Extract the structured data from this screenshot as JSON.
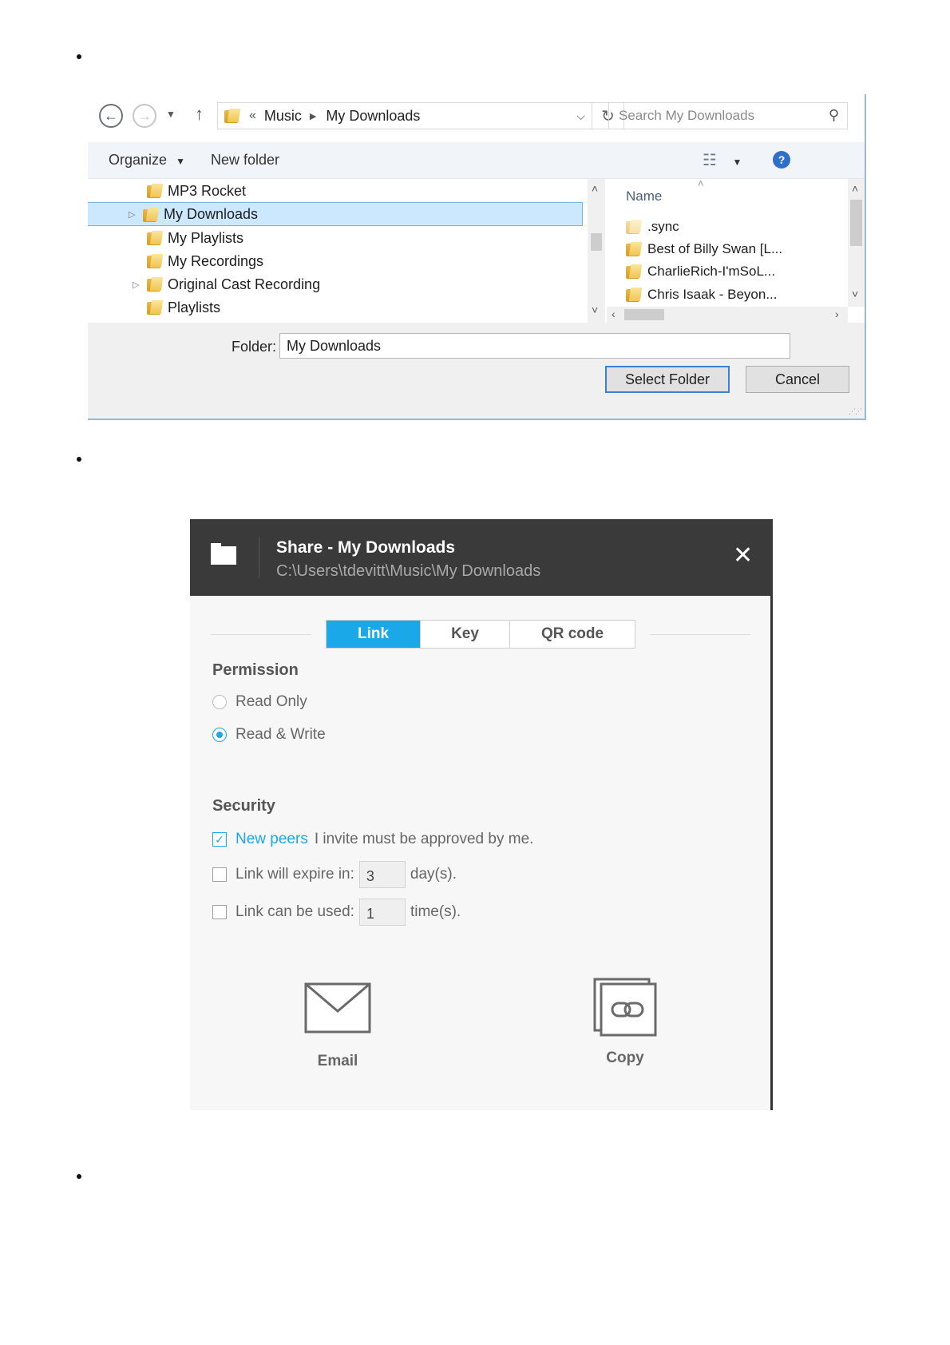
{
  "folder_picker": {
    "breadcrumb": {
      "overflow": "«",
      "items": [
        "Music",
        "My Downloads"
      ]
    },
    "search_placeholder": "Search My Downloads",
    "toolbar": {
      "organize_label": "Organize",
      "new_folder_label": "New folder"
    },
    "tree_items": [
      {
        "label": "MP3 Rocket",
        "expandable": false,
        "selected": false
      },
      {
        "label": "My Downloads",
        "expandable": true,
        "selected": true
      },
      {
        "label": "My Playlists",
        "expandable": false,
        "selected": false
      },
      {
        "label": "My Recordings",
        "expandable": false,
        "selected": false
      },
      {
        "label": "Original Cast Recording",
        "expandable": true,
        "selected": false
      },
      {
        "label": "Playlists",
        "expandable": false,
        "selected": false
      }
    ],
    "list": {
      "column_header": "Name",
      "items": [
        ".sync",
        "Best of Billy Swan [L...",
        "CharlieRich-I'mSoL...",
        "Chris Isaak - Beyon..."
      ]
    },
    "folder_label": "Folder:",
    "folder_value": "My Downloads",
    "select_folder_label": "Select Folder",
    "cancel_label": "Cancel"
  },
  "share_dialog": {
    "title": "Share - My Downloads",
    "path": "C:\\Users\\tdevitt\\Music\\My Downloads",
    "close_glyph": "✕",
    "tabs": [
      {
        "label": "Link",
        "active": true
      },
      {
        "label": "Key",
        "active": false
      },
      {
        "label": "QR code",
        "active": false
      }
    ],
    "permission": {
      "title": "Permission",
      "options": [
        {
          "label": "Read Only",
          "selected": false
        },
        {
          "label": "Read & Write",
          "selected": true
        }
      ]
    },
    "security": {
      "title": "Security",
      "new_peers_highlight": "New peers",
      "new_peers_rest": "I invite must be approved by me.",
      "new_peers_checked": true,
      "expire_label": "Link will expire in:",
      "expire_value": "3",
      "expire_unit": "day(s).",
      "expire_checked": false,
      "uses_label": "Link can be used:",
      "uses_value": "1",
      "uses_unit": "time(s).",
      "uses_checked": false
    },
    "actions": {
      "email_label": "Email",
      "copy_label": "Copy"
    }
  },
  "colors": {
    "accent": "#1aa8e8",
    "header_bg": "#3a3a3b",
    "selection_bg": "#cce8ff"
  }
}
